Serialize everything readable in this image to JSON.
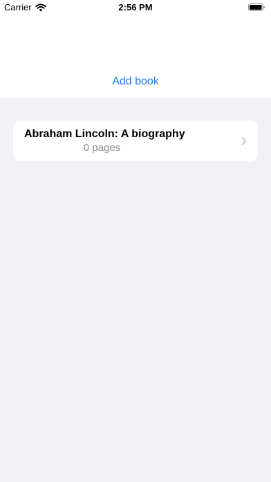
{
  "status_bar": {
    "carrier": "Carrier",
    "time": "2:56 PM",
    "icons": [
      "wifi-icon",
      "battery-icon"
    ]
  },
  "toolbar": {
    "add_book_label": "Add book"
  },
  "books": [
    {
      "title": "Abraham Lincoln: A biography",
      "pages": "0 pages"
    }
  ],
  "colors": {
    "accent": "#1a7ee6",
    "background": "#f2f1f6",
    "card": "#ffffff",
    "secondary_text": "#8a8a8e"
  }
}
